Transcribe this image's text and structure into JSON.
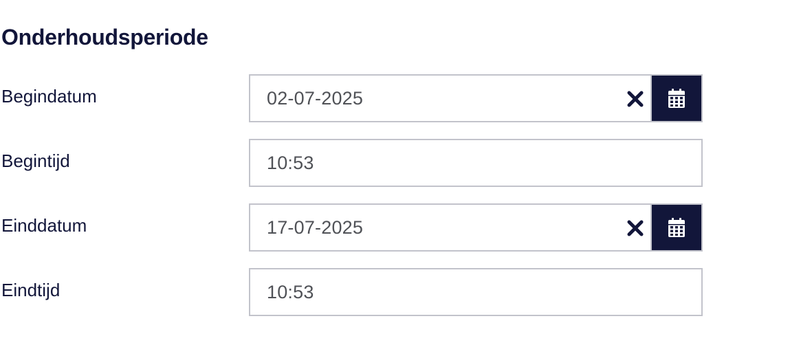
{
  "section": {
    "title": "Onderhoudsperiode"
  },
  "fields": {
    "start_date": {
      "label": "Begindatum",
      "value": "02-07-2025",
      "clear_icon": "close-icon",
      "calendar_icon": "calendar-icon"
    },
    "start_time": {
      "label": "Begintijd",
      "value": "10:53"
    },
    "end_date": {
      "label": "Einddatum",
      "value": "17-07-2025",
      "clear_icon": "close-icon",
      "calendar_icon": "calendar-icon"
    },
    "end_time": {
      "label": "Eindtijd",
      "value": "10:53"
    }
  },
  "colors": {
    "text": "#12163a",
    "button_bg": "#12163a",
    "border": "#c2c3cb",
    "value_text": "#505257"
  }
}
